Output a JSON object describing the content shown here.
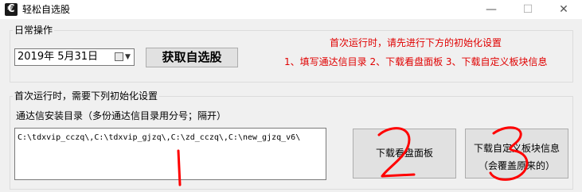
{
  "window": {
    "title": "轻松自选股",
    "icon_name": "app-logo-icon",
    "minimize_label": "—",
    "maximize_label": "☐",
    "close_label": "✕"
  },
  "daily_ops": {
    "group_label": "日常操作",
    "date_value": "2019年  5月31日",
    "calendar_icon": "calendar-icon",
    "get_stocks_label": "获取自选股",
    "hint_line1": "首次运行时，请先进行下方的初始化设置",
    "hint_line2": "1、填写通达信目录 2、下载看盘面板 3、下载自定义板块信息"
  },
  "init": {
    "group_label": "首次运行时，需要下列初始化设置",
    "path_label": "通达信安装目录（多份通达信目录用分号；隔开）",
    "path_value": "C:\\tdxvip_cczq\\,C:\\tdxvip_gjzq\\,C:\\zd_cczq\\,C:\\new_gjzq_v6\\",
    "download_board_label": "下载看盘面板",
    "download_block_line1": "下载自定义板块信息",
    "download_block_line2": "（会覆盖原来的）"
  },
  "annotations": {
    "marks": [
      "1",
      "2",
      "3"
    ],
    "color": "#ff0000"
  }
}
